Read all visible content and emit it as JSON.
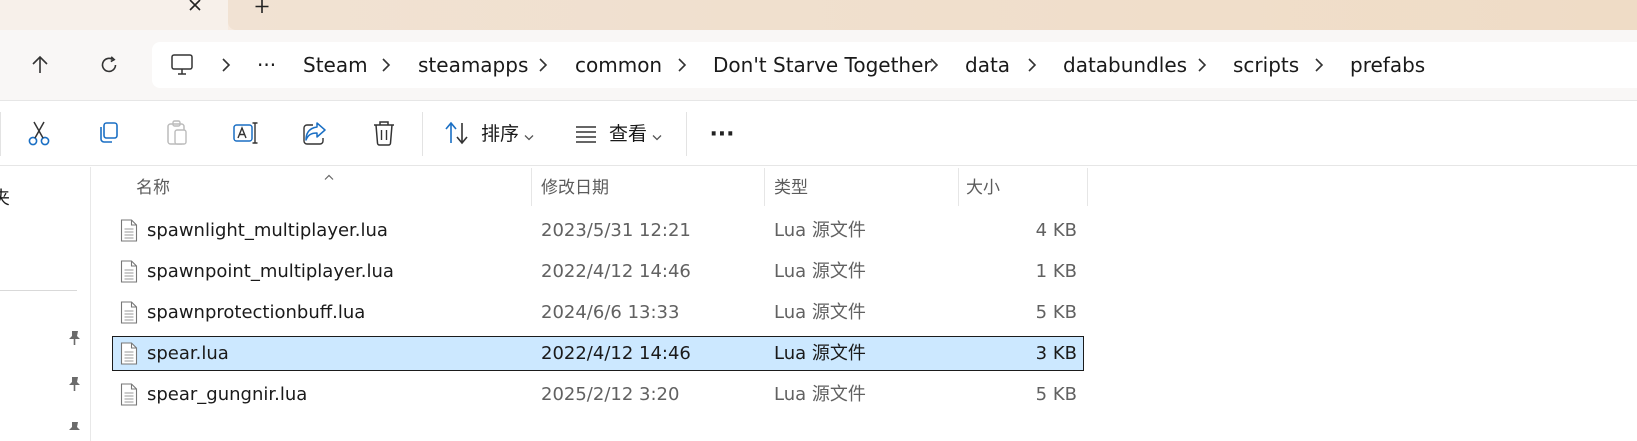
{
  "tabs": {
    "close_icon": "close-icon",
    "new_tab_icon": "plus-icon"
  },
  "nav": {
    "up_icon": "arrow-up-icon",
    "refresh_icon": "refresh-icon"
  },
  "address": {
    "computer_icon": "monitor-icon",
    "more": "···",
    "crumbs": [
      "Steam",
      "steamapps",
      "common",
      "Don't Starve Together",
      "data",
      "databundles",
      "scripts",
      "prefabs"
    ]
  },
  "toolbar": {
    "sort_label": "排序",
    "view_label": "查看",
    "more_label": "···"
  },
  "sidebar": {
    "partial_text": "夹"
  },
  "columns": {
    "name": "名称",
    "date": "修改日期",
    "type": "类型",
    "size": "大小"
  },
  "files": [
    {
      "name": "spawnlight_multiplayer.lua",
      "date": "2023/5/31 12:21",
      "type": "Lua 源文件",
      "size": "4 KB",
      "selected": false
    },
    {
      "name": "spawnpoint_multiplayer.lua",
      "date": "2022/4/12 14:46",
      "type": "Lua 源文件",
      "size": "1 KB",
      "selected": false
    },
    {
      "name": "spawnprotectionbuff.lua",
      "date": "2024/6/6 13:33",
      "type": "Lua 源文件",
      "size": "5 KB",
      "selected": false
    },
    {
      "name": "spear.lua",
      "date": "2022/4/12 14:46",
      "type": "Lua 源文件",
      "size": "3 KB",
      "selected": true
    },
    {
      "name": "spear_gungnir.lua",
      "date": "2025/2/12 3:20",
      "type": "Lua 源文件",
      "size": "5 KB",
      "selected": false
    }
  ],
  "colors": {
    "selection": "#cce8ff",
    "accent": "#1a6fc4"
  }
}
